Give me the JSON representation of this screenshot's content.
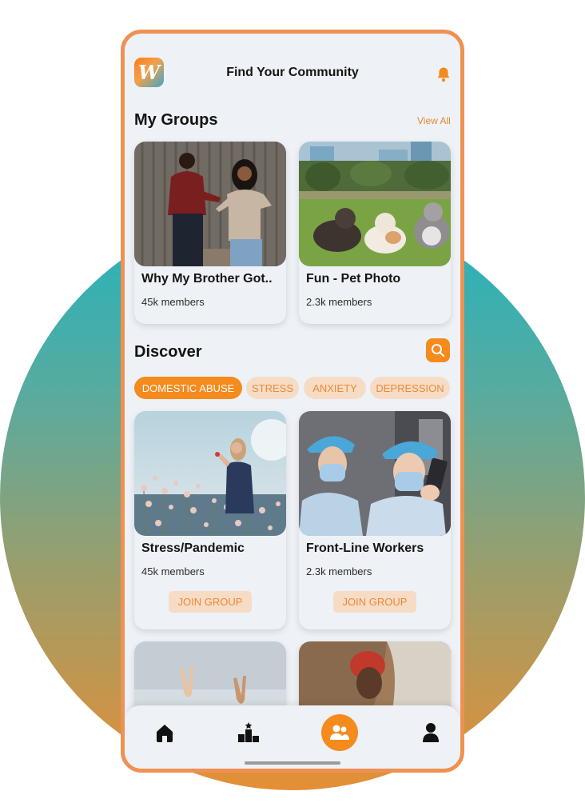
{
  "header": {
    "title": "Find Your Community",
    "logo_letter": "W",
    "notification_icon": "bell-icon"
  },
  "my_groups": {
    "title": "My Groups",
    "view_all_label": "View All",
    "groups": [
      {
        "name": "Why My Brother Got..",
        "members": "45k members"
      },
      {
        "name": "Fun - Pet Photo",
        "members": "2.3k members"
      }
    ]
  },
  "discover": {
    "title": "Discover",
    "search_icon": "search-icon",
    "chips": [
      {
        "label": "DOMESTIC ABUSE",
        "active": true
      },
      {
        "label": "STRESS",
        "active": false
      },
      {
        "label": "ANXIETY",
        "active": false
      },
      {
        "label": "DEPRESSION",
        "active": false
      }
    ],
    "groups": [
      {
        "name": "Stress/Pandemic",
        "members": "45k members",
        "join_label": "JOIN GROUP"
      },
      {
        "name": "Front-Line Workers",
        "members": "2.3k members",
        "join_label": "JOIN GROUP"
      }
    ]
  },
  "bottom_nav": {
    "items": [
      {
        "icon": "home-icon",
        "active": false
      },
      {
        "icon": "leaderboard-icon",
        "active": false
      },
      {
        "icon": "community-icon",
        "active": true
      },
      {
        "icon": "profile-icon",
        "active": false
      }
    ]
  },
  "colors": {
    "accent": "#f58a1d",
    "chip_idle_bg": "#f7dcc5",
    "phone_border": "#ee9152",
    "screen_bg": "#eef2f6"
  }
}
